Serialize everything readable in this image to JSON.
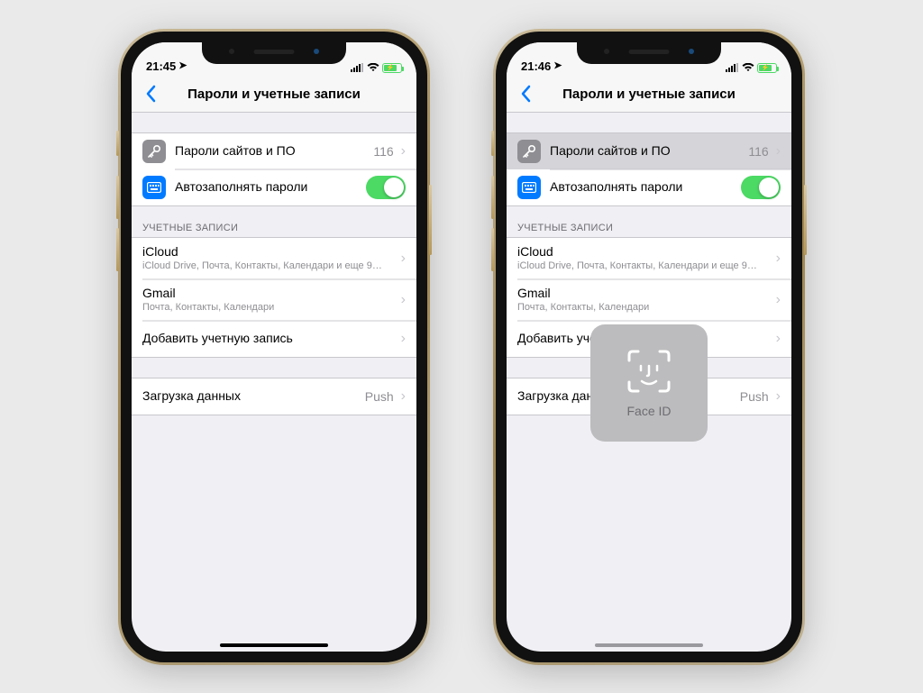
{
  "phones": [
    {
      "status": {
        "time": "21:45"
      },
      "nav": {
        "title": "Пароли и учетные записи"
      },
      "passwords": {
        "label": "Пароли сайтов и ПО",
        "count": "116",
        "highlighted": false
      },
      "autofill": {
        "label": "Автозаполнять пароли",
        "on": true
      },
      "accounts_header": "УЧЕТНЫЕ ЗАПИСИ",
      "accounts": [
        {
          "title": "iCloud",
          "subtitle": "iCloud Drive, Почта, Контакты, Календари и еще 9…"
        },
        {
          "title": "Gmail",
          "subtitle": "Почта, Контакты, Календари"
        }
      ],
      "add_account_label": "Добавить учетную запись",
      "fetch": {
        "label": "Загрузка данных",
        "value": "Push"
      },
      "home_indicator": "dark",
      "faceid": false
    },
    {
      "status": {
        "time": "21:46"
      },
      "nav": {
        "title": "Пароли и учетные записи"
      },
      "passwords": {
        "label": "Пароли сайтов и ПО",
        "count": "116",
        "highlighted": true
      },
      "autofill": {
        "label": "Автозаполнять пароли",
        "on": true
      },
      "accounts_header": "УЧЕТНЫЕ ЗАПИСИ",
      "accounts": [
        {
          "title": "iCloud",
          "subtitle": "iCloud Drive, Почта, Контакты, Календари и еще 9…"
        },
        {
          "title": "Gmail",
          "subtitle": "Почта, Контакты, Календари"
        }
      ],
      "add_account_label": "Добавить учетную запись",
      "fetch": {
        "label": "Загрузка данных",
        "value": "Push"
      },
      "home_indicator": "light",
      "faceid": true,
      "faceid_label": "Face ID"
    }
  ]
}
